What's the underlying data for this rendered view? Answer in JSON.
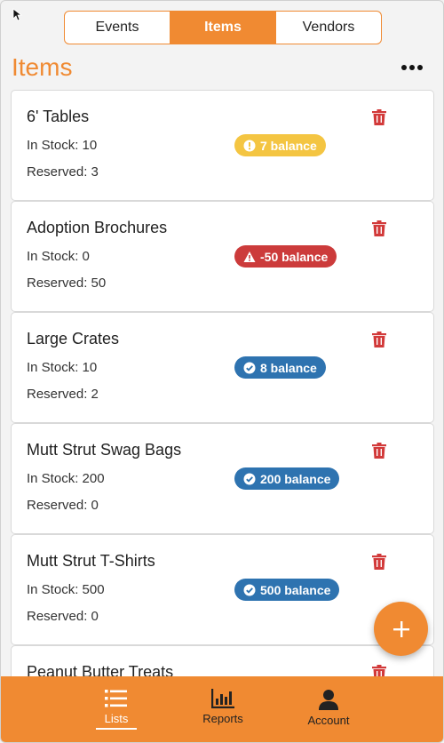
{
  "segments": [
    {
      "label": "Events",
      "active": false
    },
    {
      "label": "Items",
      "active": true
    },
    {
      "label": "Vendors",
      "active": false
    }
  ],
  "page_title": "Items",
  "items": [
    {
      "name": "6' Tables",
      "stock": "In Stock: 10",
      "reserved": "Reserved: 3",
      "badge": "7 balance",
      "status": "warning",
      "color": "#f4c542"
    },
    {
      "name": "Adoption Brochures",
      "stock": "In Stock: 0",
      "reserved": "Reserved: 50",
      "badge": "-50 balance",
      "status": "danger",
      "color": "#cc3b3b"
    },
    {
      "name": "Large Crates",
      "stock": "In Stock: 10",
      "reserved": "Reserved: 2",
      "badge": "8 balance",
      "status": "ok",
      "color": "#2e73b0"
    },
    {
      "name": "Mutt Strut Swag Bags",
      "stock": "In Stock: 200",
      "reserved": "Reserved: 0",
      "badge": "200 balance",
      "status": "ok",
      "color": "#2e73b0"
    },
    {
      "name": "Mutt Strut T-Shirts",
      "stock": "In Stock: 500",
      "reserved": "Reserved: 0",
      "badge": "500 balance",
      "status": "ok",
      "color": "#2e73b0"
    },
    {
      "name": "Peanut Butter Treats",
      "stock": "",
      "reserved": "",
      "badge": "",
      "status": "",
      "color": ""
    }
  ],
  "tabs": [
    {
      "label": "Lists",
      "icon": "list-icon",
      "active": true
    },
    {
      "label": "Reports",
      "icon": "bar-chart-icon",
      "active": false
    },
    {
      "label": "Account",
      "icon": "user-icon",
      "active": false
    }
  ],
  "colors": {
    "accent": "#f08a32",
    "trash": "#d23a3a"
  }
}
